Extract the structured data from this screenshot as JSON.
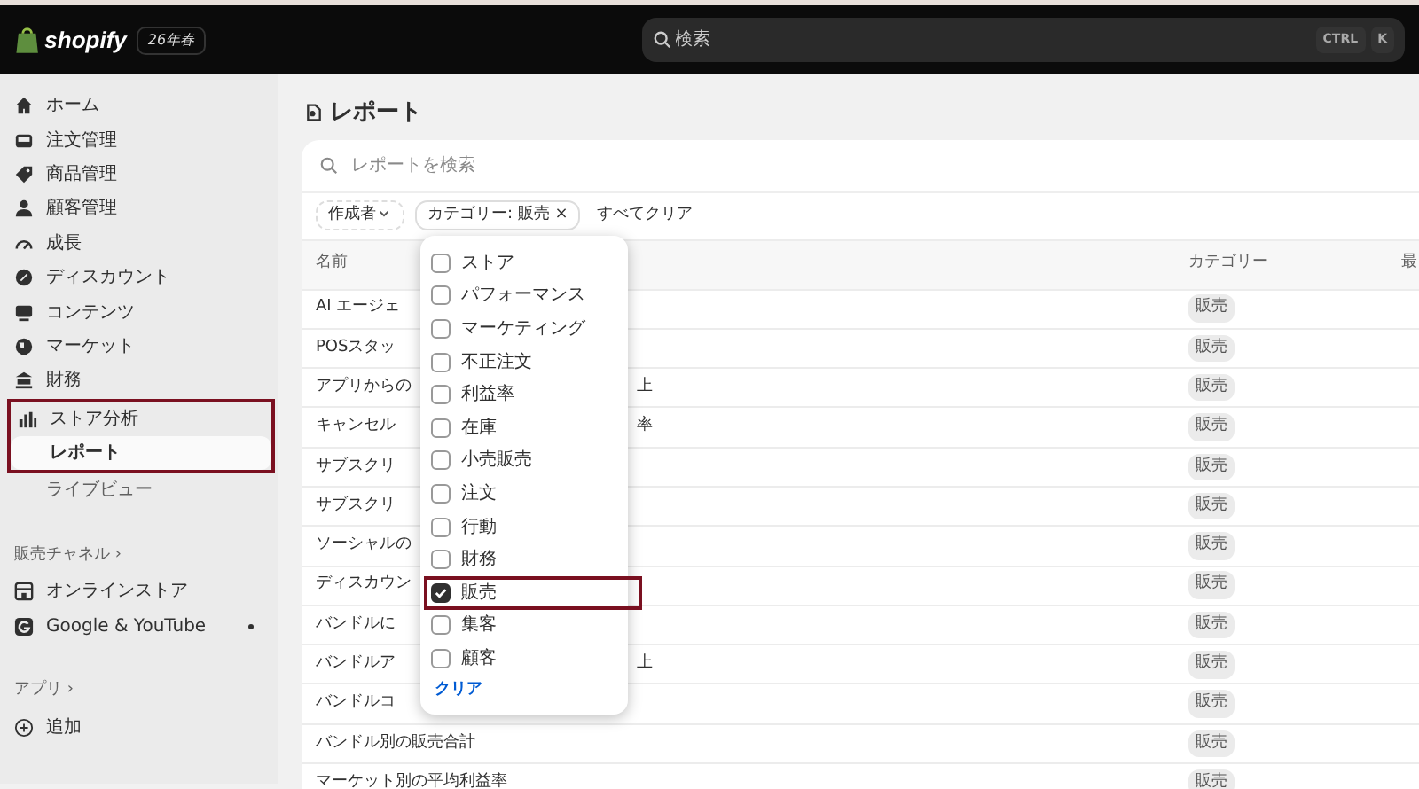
{
  "topbar": {
    "logo": "shopify",
    "edition": "26年春",
    "search": {
      "placeholder": "検索"
    },
    "shortcut": [
      "CTRL",
      "K"
    ]
  },
  "sidebar": {
    "items": [
      {
        "label": "ホーム",
        "selected": false
      },
      {
        "label": "注文管理",
        "selected": false
      },
      {
        "label": "商品管理",
        "selected": false
      },
      {
        "label": "顧客管理",
        "selected": false
      },
      {
        "label": "成長",
        "selected": false
      },
      {
        "label": "ディスカウント",
        "selected": false
      },
      {
        "label": "コンテンツ",
        "selected": false
      },
      {
        "label": "マーケット",
        "selected": false
      },
      {
        "label": "財務",
        "selected": false
      },
      {
        "label": "ストア分析",
        "selected": false,
        "highlighted": true,
        "children": [
          {
            "label": "レポート",
            "selected": true,
            "highlighted": true
          },
          {
            "label": "ライブビュー",
            "selected": false,
            "highlighted": false
          }
        ]
      }
    ],
    "sections": [
      {
        "title": "販売チャネル ›",
        "items": [
          {
            "label": "オンラインストア",
            "dot": false
          },
          {
            "label": "Google & YouTube",
            "dot": true
          }
        ]
      },
      {
        "title": "アプリ ›",
        "items": [
          {
            "label": "追加",
            "dot": false
          }
        ]
      }
    ]
  },
  "page": {
    "title": "レポート",
    "search": {
      "placeholder": "レポートを検索"
    },
    "filters": [
      {
        "kind": "dropdown",
        "label": "作成者"
      },
      {
        "kind": "applied",
        "label": "カテゴリー: 販売",
        "remove": "×"
      },
      {
        "kind": "link",
        "label": "すべてクリア"
      }
    ],
    "table": {
      "columns": [
        "名前",
        "カテゴリー",
        "最"
      ],
      "rows": [
        {
          "name": "AI エージェ",
          "category": "販売"
        },
        {
          "name": "POSスタッ",
          "category": "販売"
        },
        {
          "name": "アプリからの",
          "tail": "上",
          "category": "販売"
        },
        {
          "name": "キャンセル",
          "tail": "率",
          "category": "販売"
        },
        {
          "name": "サブスクリ",
          "category": "販売"
        },
        {
          "name": "サブスクリ",
          "category": "販売"
        },
        {
          "name": "ソーシャルの",
          "category": "販売"
        },
        {
          "name": "ディスカウン",
          "category": "販売"
        },
        {
          "name": "バンドルに",
          "category": "販売"
        },
        {
          "name": "バンドルア",
          "tail": "上",
          "category": "販売"
        },
        {
          "name": "バンドルコ",
          "category": "販売"
        },
        {
          "name": "バンドル別の販売合計",
          "category": "販売"
        },
        {
          "name": "マーケット別の平均利益率",
          "category": "販売"
        }
      ]
    },
    "category_menu": {
      "options": [
        {
          "label": "ストア",
          "checked": false,
          "highlighted": false
        },
        {
          "label": "パフォーマンス",
          "checked": false,
          "highlighted": false
        },
        {
          "label": "マーケティング",
          "checked": false,
          "highlighted": false
        },
        {
          "label": "不正注文",
          "checked": false,
          "highlighted": false
        },
        {
          "label": "利益率",
          "checked": false,
          "highlighted": false
        },
        {
          "label": "在庫",
          "checked": false,
          "highlighted": false
        },
        {
          "label": "小売販売",
          "checked": false,
          "highlighted": false
        },
        {
          "label": "注文",
          "checked": false,
          "highlighted": false
        },
        {
          "label": "行動",
          "checked": false,
          "highlighted": false
        },
        {
          "label": "財務",
          "checked": false,
          "highlighted": false
        },
        {
          "label": "販売",
          "checked": true,
          "highlighted": true
        },
        {
          "label": "集客",
          "checked": false,
          "highlighted": false
        },
        {
          "label": "顧客",
          "checked": false,
          "highlighted": false
        }
      ],
      "clear": "クリア"
    }
  }
}
